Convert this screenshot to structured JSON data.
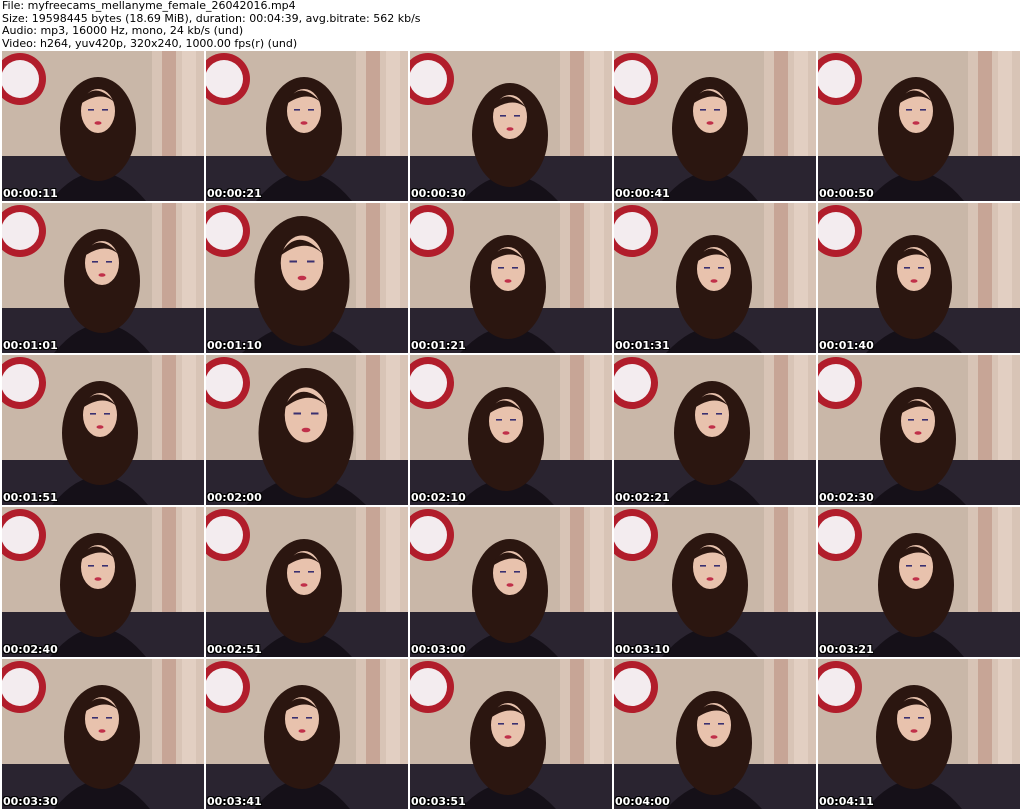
{
  "info": {
    "file": "File: myfreecams_mellanyme_female_26042016.mp4",
    "size": "Size: 19598445 bytes (18.69 MiB), duration: 00:04:39, avg.bitrate: 562 kb/s",
    "audio": "Audio: mp3, 16000 Hz, mono, 24 kb/s (und)",
    "video": "Video: h264, yuv420p, 320x240, 1000.00 fps(r) (und)"
  },
  "thumbnails": [
    {
      "time": "00:00:11",
      "pose": "center"
    },
    {
      "time": "00:00:21",
      "pose": "center"
    },
    {
      "time": "00:00:30",
      "pose": "down"
    },
    {
      "time": "00:00:41",
      "pose": "center"
    },
    {
      "time": "00:00:50",
      "pose": "center"
    },
    {
      "time": "00:01:01",
      "pose": "center"
    },
    {
      "time": "00:01:10",
      "pose": "close"
    },
    {
      "time": "00:01:21",
      "pose": "down"
    },
    {
      "time": "00:01:31",
      "pose": "down"
    },
    {
      "time": "00:01:40",
      "pose": "down"
    },
    {
      "time": "00:01:51",
      "pose": "center"
    },
    {
      "time": "00:02:00",
      "pose": "close"
    },
    {
      "time": "00:02:10",
      "pose": "down"
    },
    {
      "time": "00:02:21",
      "pose": "center"
    },
    {
      "time": "00:02:30",
      "pose": "down"
    },
    {
      "time": "00:02:40",
      "pose": "center"
    },
    {
      "time": "00:02:51",
      "pose": "down"
    },
    {
      "time": "00:03:00",
      "pose": "down"
    },
    {
      "time": "00:03:10",
      "pose": "center"
    },
    {
      "time": "00:03:21",
      "pose": "center"
    },
    {
      "time": "00:03:30",
      "pose": "center"
    },
    {
      "time": "00:03:41",
      "pose": "center"
    },
    {
      "time": "00:03:51",
      "pose": "down"
    },
    {
      "time": "00:04:00",
      "pose": "down"
    },
    {
      "time": "00:04:11",
      "pose": "center"
    }
  ],
  "colors": {
    "background": "#ffffff",
    "hair": "#2b1610",
    "skin": "#e8c2ad",
    "shirt": "#151018",
    "sofa": "#2a2430",
    "wall": "#c9b7a8",
    "sign_red": "#b11d2b",
    "lips": "#c0304a"
  }
}
